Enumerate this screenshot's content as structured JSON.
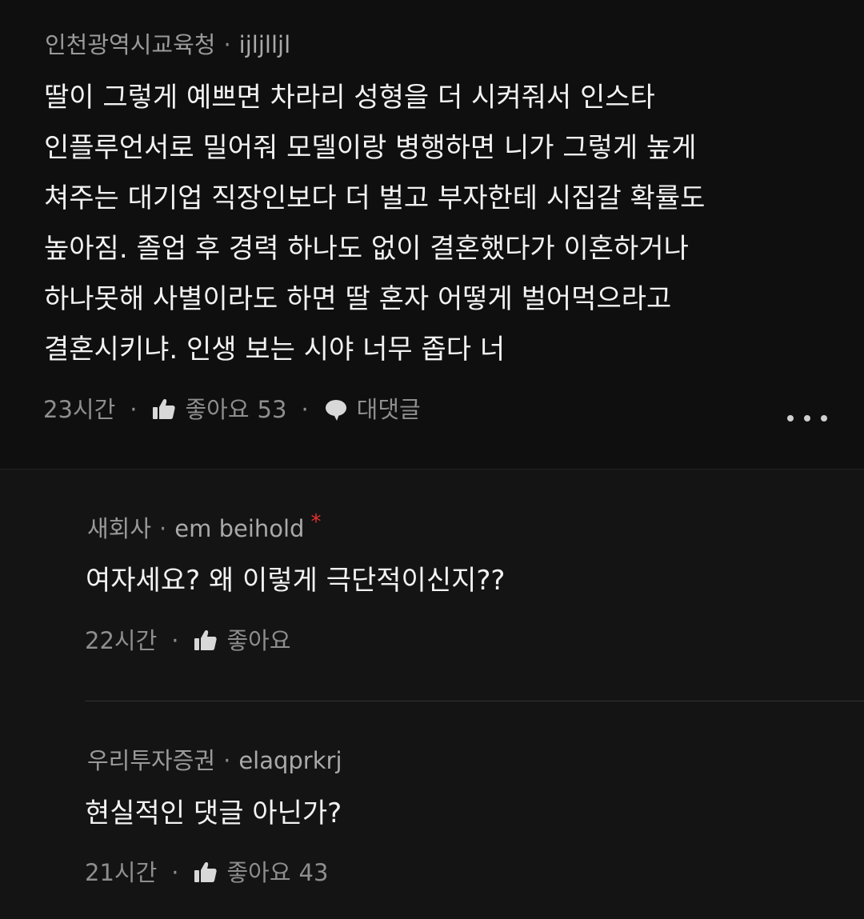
{
  "main_comment": {
    "company": "인천광역시교육청",
    "separator": "·",
    "nickname": "ijljlljl",
    "body_lines": [
      "딸이 그렇게 예쁘면 차라리 성형을 더 시켜줘서 인스타",
      "인플루언서로 밀어줘 모델이랑 병행하면 니가 그렇게 높게",
      "쳐주는 대기업 직장인보다 더 벌고 부자한테 시집갈 확률도",
      "높아짐. 졸업 후 경력 하나도 없이 결혼했다가 이혼하거나",
      "하나못해 사별이라도 하면 딸 혼자 어떻게 벌어먹으라고",
      "결혼시키냐. 인생 보는 시야 너무 좁다 너"
    ],
    "time": "23시간",
    "like_label": "좋아요",
    "like_count": "53",
    "reply_label": "대댓글",
    "dot": "·"
  },
  "replies": [
    {
      "company": "새회사",
      "separator": "·",
      "nickname": "em beihold",
      "badge": "*",
      "body": "여자세요? 왜 이렇게 극단적이신지??",
      "time": "22시간",
      "dot": "·",
      "like_label": "좋아요",
      "like_count": ""
    },
    {
      "company": "우리투자증권",
      "separator": "·",
      "nickname": "elaqprkrj",
      "body": "현실적인 댓글 아닌가?",
      "time": "21시간",
      "dot": "·",
      "like_label": "좋아요",
      "like_count": "43"
    }
  ],
  "colors": {
    "badge": "#e0312f",
    "background": "#0f0f0f",
    "text": "#f2f2f2",
    "meta": "#8e8e8e"
  },
  "icons": {
    "like": "thumbs-up-icon",
    "reply": "speech-bubble-icon",
    "more": "more-dots-icon"
  }
}
